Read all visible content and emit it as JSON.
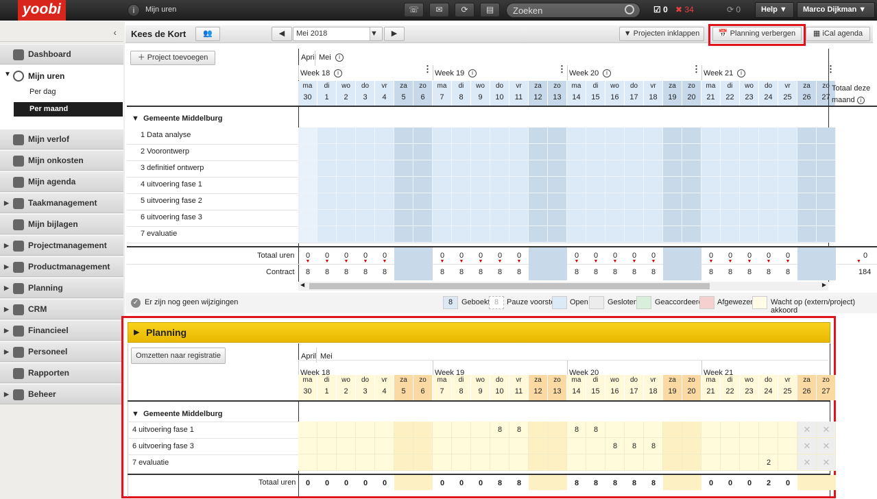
{
  "topbar": {
    "logo": "yoobi",
    "section": "Mijn uren",
    "search_placeholder": "Zoeken",
    "tasks_count": "0",
    "alerts_count": "34",
    "sync_count": "0",
    "help": "Help",
    "user": "Marco Dijkman"
  },
  "sidebar": {
    "items": [
      {
        "label": "Dashboard"
      },
      {
        "label": "Mijn uren",
        "sub": [
          "Per dag",
          "Per maand"
        ]
      },
      {
        "label": "Mijn verlof"
      },
      {
        "label": "Mijn onkosten"
      },
      {
        "label": "Mijn agenda"
      },
      {
        "label": "Taakmanagement"
      },
      {
        "label": "Mijn bijlagen"
      },
      {
        "label": "Projectmanagement"
      },
      {
        "label": "Productmanagement"
      },
      {
        "label": "Planning"
      },
      {
        "label": "CRM"
      },
      {
        "label": "Financieel"
      },
      {
        "label": "Personeel"
      },
      {
        "label": "Rapporten"
      },
      {
        "label": "Beheer"
      }
    ]
  },
  "header": {
    "employee": "Kees de Kort",
    "month": "Mei 2018",
    "collapse": "Projecten inklappen",
    "planning_hide": "Planning verbergen",
    "ical": "iCal agenda"
  },
  "toolbar": {
    "add_project": "Project toevoegen",
    "convert": "Omzetten naar registratie"
  },
  "calendar": {
    "months": [
      "April",
      "Mei"
    ],
    "weeks": [
      "Week 18",
      "Week 19",
      "Week 20",
      "Week 21"
    ],
    "days": [
      {
        "d": "ma",
        "n": "30"
      },
      {
        "d": "di",
        "n": "1"
      },
      {
        "d": "wo",
        "n": "2"
      },
      {
        "d": "do",
        "n": "3"
      },
      {
        "d": "vr",
        "n": "4"
      },
      {
        "d": "za",
        "n": "5"
      },
      {
        "d": "zo",
        "n": "6"
      },
      {
        "d": "ma",
        "n": "7"
      },
      {
        "d": "di",
        "n": "8"
      },
      {
        "d": "wo",
        "n": "9"
      },
      {
        "d": "do",
        "n": "10"
      },
      {
        "d": "vr",
        "n": "11"
      },
      {
        "d": "za",
        "n": "12"
      },
      {
        "d": "zo",
        "n": "13"
      },
      {
        "d": "ma",
        "n": "14"
      },
      {
        "d": "di",
        "n": "15"
      },
      {
        "d": "wo",
        "n": "16"
      },
      {
        "d": "do",
        "n": "17"
      },
      {
        "d": "vr",
        "n": "18"
      },
      {
        "d": "za",
        "n": "19"
      },
      {
        "d": "zo",
        "n": "20"
      },
      {
        "d": "ma",
        "n": "21"
      },
      {
        "d": "di",
        "n": "22"
      },
      {
        "d": "wo",
        "n": "23"
      },
      {
        "d": "do",
        "n": "24"
      },
      {
        "d": "vr",
        "n": "25"
      },
      {
        "d": "za",
        "n": "26"
      },
      {
        "d": "zo",
        "n": "27"
      }
    ],
    "total_header": "Totaal deze maand"
  },
  "registration": {
    "group": "Gemeente Middelburg",
    "rows": [
      "1 Data analyse",
      "2 Voorontwerp",
      "3 definitief ontwerp",
      "4 uitvoering fase 1",
      "5 uitvoering fase 2",
      "6 uitvoering fase 3",
      "7 evaluatie"
    ],
    "total_label": "Totaal uren",
    "contract_label": "Contract",
    "totals": [
      "0",
      "0",
      "0",
      "0",
      "0",
      "",
      "",
      "0",
      "0",
      "0",
      "0",
      "0",
      "",
      "",
      "0",
      "0",
      "0",
      "0",
      "0",
      "",
      "",
      "0",
      "0",
      "0",
      "0",
      "0",
      "",
      ""
    ],
    "contract": [
      "8",
      "8",
      "8",
      "8",
      "8",
      "",
      "",
      "8",
      "8",
      "8",
      "8",
      "8",
      "",
      "",
      "8",
      "8",
      "8",
      "8",
      "8",
      "",
      "",
      "8",
      "8",
      "8",
      "8",
      "8",
      "",
      ""
    ],
    "month_total": "0",
    "month_contract": "184"
  },
  "status": {
    "message": "Er zijn nog geen wijzigingen",
    "legend": [
      {
        "label": "Geboekt",
        "sample": "8",
        "color": "#dce8f4"
      },
      {
        "label": "Pauze voorstel",
        "sample": "8",
        "color": "#ffffff"
      },
      {
        "label": "Open",
        "color": "#dce9f7"
      },
      {
        "label": "Gesloten",
        "color": "#ececec"
      },
      {
        "label": "Geaccordeerd",
        "color": "#d9efdb"
      },
      {
        "label": "Afgewezen",
        "color": "#f6cfcf"
      },
      {
        "label": "Wacht op (extern/project) akkoord",
        "color": "#fffbe6"
      }
    ]
  },
  "planning": {
    "title": "Planning",
    "group": "Gemeente Middelburg",
    "rows": [
      {
        "label": "4 uitvoering fase 1",
        "vals": {
          "10": "8",
          "11": "8",
          "14": "8",
          "15": "8"
        }
      },
      {
        "label": "6 uitvoering fase 3",
        "vals": {
          "16": "8",
          "17": "8",
          "18": "8"
        }
      },
      {
        "label": "7 evaluatie",
        "vals": {
          "24": "2"
        }
      }
    ],
    "total_label": "Totaal uren",
    "totals": [
      "0",
      "0",
      "0",
      "0",
      "0",
      "",
      "",
      "0",
      "0",
      "0",
      "8",
      "8",
      "",
      "",
      "8",
      "8",
      "8",
      "8",
      "8",
      "",
      "",
      "0",
      "0",
      "0",
      "2",
      "0",
      "",
      ""
    ]
  },
  "colors": {
    "accent": "#e0121b",
    "planning_header": "#f6c700",
    "open": "#dce9f7",
    "weekend": "#c9d9ea",
    "plan_cell": "#fffbdb",
    "plan_weekend": "#fdf0c2"
  }
}
